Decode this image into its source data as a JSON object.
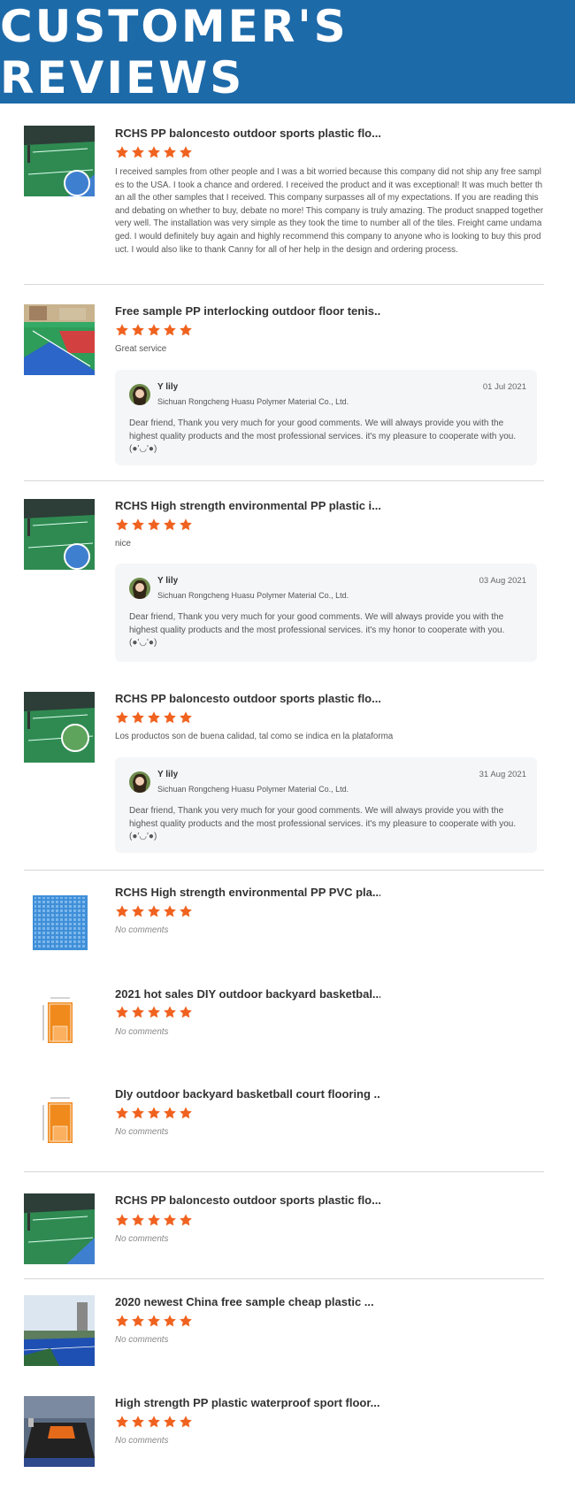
{
  "header": {
    "title": "CUSTOMER'S REVIEWS"
  },
  "colors": {
    "banner": "#1d6aa9",
    "star": "#f0621f"
  },
  "reviews": [
    {
      "product": "RCHS PP baloncesto outdoor sports plastic flo...",
      "rating": 5,
      "comment": "I received samples from other people and I was a bit worried because this company did not ship any free samples to the USA. I took a chance and ordered. I received the product and it was exceptional! It was much better than all the other samples that I received. This company surpasses all of my expectations. If you are reading this and debating on whether to buy, debate no more! This company is truly amazing. The product snapped together very well. The installation was very simple as they took the time to number all of the tiles. Freight came undamaged. I would definitely buy again and highly recommend this company to anyone who is looking to buy this product. I would also like to thank Canny for all of her help in the design and ordering process.",
      "thumb": "court-green-icon"
    },
    {
      "product": "Free sample PP interlocking outdoor floor tenis...",
      "rating": 5,
      "comment": "Great service",
      "thumb": "court-outdoor-icon",
      "reply": {
        "name": "Y lily",
        "company": "Sichuan Rongcheng Huasu Polymer Material Co., Ltd.",
        "date": "01 Jul 2021",
        "text": "Dear friend, Thank you very much for your good comments. We will always provide you with the highest quality products and the most professional services. it's my pleasure to cooperate with you. (●'◡'●)"
      }
    },
    {
      "product": "RCHS High strength environmental PP plastic i...",
      "rating": 5,
      "comment": "nice",
      "thumb": "court-green-icon",
      "reply": {
        "name": "Y lily",
        "company": "Sichuan Rongcheng Huasu Polymer Material Co., Ltd.",
        "date": "03 Aug 2021",
        "text": "Dear friend, Thank you very much for your good comments. We will always provide you with the highest quality products and the most professional services. it's my honor to cooperate with you. (●'◡'●)"
      }
    },
    {
      "product": "RCHS PP baloncesto outdoor sports plastic flo...",
      "rating": 5,
      "comment": "Los productos son de buena calidad, tal como se indica en la plataforma",
      "thumb": "court-green-icon",
      "reply": {
        "name": "Y lily",
        "company": "Sichuan Rongcheng Huasu Polymer Material Co., Ltd.",
        "date": "31 Aug 2021",
        "text": "Dear friend, Thank you very much for your good comments. We will always provide you with the highest quality products and the most professional services. it's my pleasure to cooperate with you. (●'◡'●)"
      }
    },
    {
      "product": "RCHS High strength environmental PP PVC pla...",
      "rating": 5,
      "comment": "No comments",
      "thumb": "tile-blue-icon"
    },
    {
      "product": "2021 hot sales DIY outdoor backyard basketbal...",
      "rating": 5,
      "comment": "No comments",
      "thumb": "court-plan-icon"
    },
    {
      "product": "DIy outdoor backyard basketball court flooring ...",
      "rating": 5,
      "comment": "No comments",
      "thumb": "court-plan-icon"
    },
    {
      "product": "RCHS PP baloncesto outdoor sports plastic flo...",
      "rating": 5,
      "comment": "No comments",
      "thumb": "court-green-icon"
    },
    {
      "product": "2020 newest China free sample cheap plastic ...",
      "rating": 5,
      "comment": "No comments",
      "thumb": "court-blue-icon"
    },
    {
      "product": "High strength PP plastic waterproof sport floor...",
      "rating": 5,
      "comment": "No comments",
      "thumb": "court-indoor-icon"
    }
  ]
}
